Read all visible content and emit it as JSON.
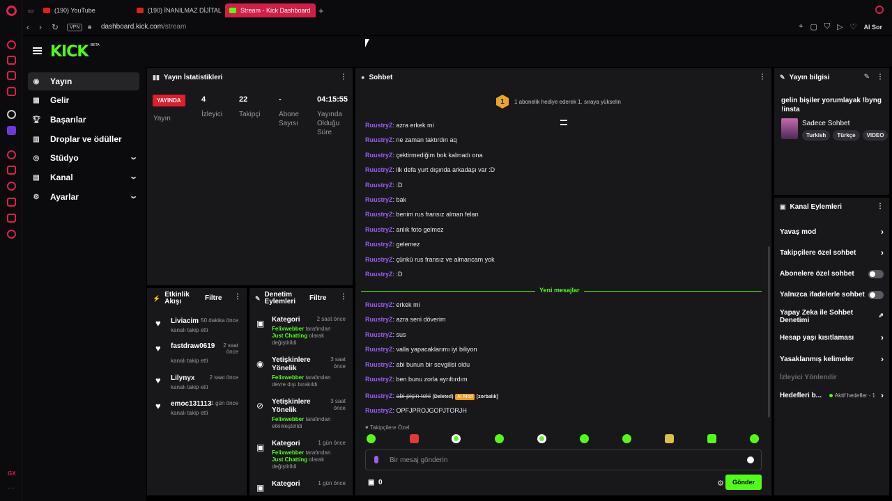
{
  "browser": {
    "tabs": [
      {
        "label": "(190) YouTube"
      },
      {
        "label": "(190) İNANILMAZ DİJİTAL"
      },
      {
        "label": "Stream - Kick Dashboard"
      }
    ],
    "vpn_label": "VPN",
    "url_host": "dashboard.kick.com",
    "url_path": "/stream",
    "ai_label": "AI Sor"
  },
  "app": {
    "logo": "KICK",
    "beta": "BETA"
  },
  "nav": {
    "items": [
      {
        "label": "Yayın",
        "icon": "broadcast-icon"
      },
      {
        "label": "Gelir",
        "icon": "revenue-icon"
      },
      {
        "label": "Başarılar",
        "icon": "trophy-icon"
      },
      {
        "label": "Droplar ve ödüller",
        "icon": "gift-icon"
      },
      {
        "label": "Stüdyo",
        "icon": "studio-icon"
      },
      {
        "label": "Kanal",
        "icon": "channel-icon"
      },
      {
        "label": "Ayarlar",
        "icon": "settings-icon"
      }
    ]
  },
  "stats": {
    "title": "Yayın İstatistikleri",
    "live_badge": "YAYINDA",
    "stream_label": "Yayın",
    "viewers_value": "4",
    "viewers_label": "İzleyici",
    "followers_value": "22",
    "followers_label": "Takipçi",
    "subs_value": "-",
    "subs_label_1": "Abone",
    "subs_label_2": "Sayısı",
    "duration_value": "04:15:55",
    "duration_label_1": "Yayında",
    "duration_label_2": "Olduğu",
    "duration_label_3": "Süre"
  },
  "activity": {
    "title_1": "Etkinlik",
    "title_2": "Akışı",
    "filter": "Filtre",
    "items": [
      {
        "name": "Liviacim",
        "time": "50 dakika önce",
        "sub": "kanalı takip etti"
      },
      {
        "name": "fastdraw0619",
        "time_1": "2 saat",
        "time_2": "önce",
        "sub": "kanalı takip etti"
      },
      {
        "name": "Lilynyx",
        "time": "2 saat önce",
        "sub": "kanalı takip etti"
      },
      {
        "name": "emoc131113",
        "time": "1 gün önce",
        "sub": "kanalı takip etti"
      }
    ]
  },
  "moderation": {
    "title_1": "Denetim",
    "title_2": "Eylemleri",
    "filter": "Filtre",
    "items": [
      {
        "title": "Kategori",
        "time": "2 saat önce",
        "user": "Felixwebber",
        "by": "tarafından",
        "extra": "Just Chatting",
        "desc": "olarak değiştirildi"
      },
      {
        "title": "Yetişkinlere Yönelik",
        "time_1": "3 saat",
        "time_2": "önce",
        "user": "Felixwebber",
        "by": "tarafından",
        "desc": "devre dışı bırakıldı"
      },
      {
        "title": "Yetişkinlere Yönelik",
        "time_1": "3 saat",
        "time_2": "önce",
        "user": "Felixwebber",
        "by": "tarafından",
        "desc": "etkinleştirildi"
      },
      {
        "title": "Kategori",
        "time": "1 gün önce",
        "user": "Felixwebber",
        "by": "tarafından",
        "extra": "Just Chatting",
        "desc": "olarak değiştirildi"
      },
      {
        "title": "Kategori",
        "time": "1 gün önce"
      }
    ]
  },
  "chat": {
    "title": "Sohbet",
    "pinned": "1 abonelik hediye ederek 1. sıraya yükselin",
    "pinned_rank": "1",
    "messages_old": [
      {
        "user": "RuustryZ",
        "text": ": azra erkek mi"
      },
      {
        "user": "RuustryZ",
        "text": ": ne zaman taktırdın aq"
      },
      {
        "user": "RuustryZ",
        "text": ": çektirmediğim bok kalmadı ona"
      },
      {
        "user": "RuustryZ",
        "text": ": ilk defa yurt dışında arkadaşı var :D"
      },
      {
        "user": "RuustryZ",
        "text": ": :D"
      },
      {
        "user": "RuustryZ",
        "text": ": bak"
      },
      {
        "user": "RuustryZ",
        "text": ": benim rus fransız alman felan"
      },
      {
        "user": "RuustryZ",
        "text": ": anlık foto gelmez"
      },
      {
        "user": "RuustryZ",
        "text": ": gelemez"
      },
      {
        "user": "RuustryZ",
        "text": ": çünkü rus fransız ve almancam yok"
      },
      {
        "user": "RuustryZ",
        "text": ": :D"
      }
    ],
    "new_messages": "Yeni mesajlar",
    "messages_new": [
      {
        "user": "RuustryZ",
        "text": ": erkek mi"
      },
      {
        "user": "RuustryZ",
        "text": ": azra seni döverim"
      },
      {
        "user": "RuustryZ",
        "text": ": sus"
      },
      {
        "user": "RuustryZ",
        "text": ": valla yapacaklarımı iyi biliyon"
      },
      {
        "user": "RuustryZ",
        "text": ": abi bunun bir sevgilisi oldu"
      },
      {
        "user": "RuustryZ",
        "text": ": ben bunu zorla ayrıltırdım"
      }
    ],
    "deleted_msg": {
      "user": "RuustryZ",
      "colon": ": ",
      "text": "abi piçin teki",
      "deleted": "(Deleted)",
      "ai_mod": "AI Mod",
      "reason": "[zorbalık]"
    },
    "last_msg": {
      "user": "RuustryZ",
      "text": ": OPFJPROJGOPJTORJH"
    },
    "followers_only": "♥ Takipçilere Özel",
    "input_placeholder": "Bir mesaj gönderin",
    "points": "0",
    "send": "Gönder"
  },
  "stream_info": {
    "title": "Yayın bilgisi",
    "stream_title_1": "gelin bişiler yorumlayak !byng",
    "stream_title_2": "!insta",
    "category": "Sadece Sohbet",
    "tags": [
      "Turkish",
      "Türkçe",
      "VIDEO"
    ]
  },
  "channel_actions": {
    "title": "Kanal Eylemleri",
    "slow_mode": "Yavaş mod",
    "followers_chat": "Takipçilere özel sohbet",
    "subs_chat": "Abonelere özel sohbet",
    "emotes_chat": "Yalnızca ifadelerle sohbet",
    "ai_mod_1": "Yapay Zeka ile Sohbet",
    "ai_mod_2": "Denetimi",
    "age_restrict": "Hesap yaşı kısıtlaması",
    "banned_words": "Yasaklanmış kelimeler",
    "viewer_redirect": "İzleyici Yönlendir",
    "goals": "Hedefleri b...",
    "goals_sub": "Aktif hedefler - 1"
  },
  "colors": {
    "kick_green": "#53fc18",
    "username_purple": "#9b5df5",
    "live_red": "#e01e2e",
    "opera_red": "#d8204a"
  }
}
